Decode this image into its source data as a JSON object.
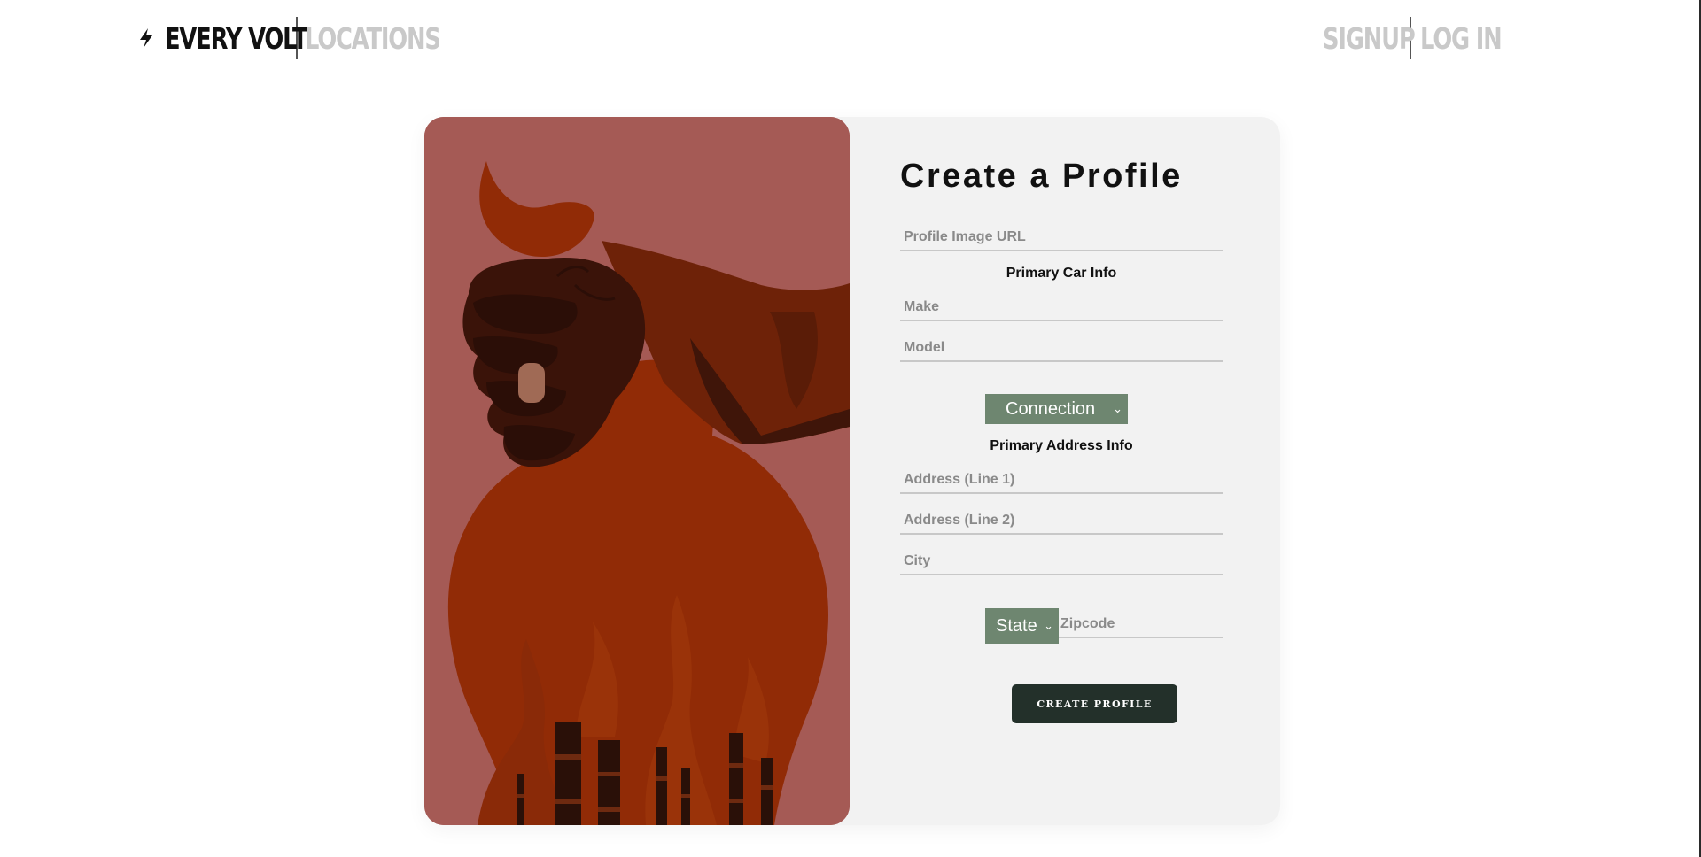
{
  "nav": {
    "brand": "EVERY VOLT",
    "brand_icon": "bolt-icon",
    "locations": "LOCATIONS",
    "signup": "SIGNUP",
    "login": "LOG IN"
  },
  "form": {
    "title": "Create a Profile",
    "profile_image_placeholder": "Profile Image URL",
    "car_section": "Primary Car Info",
    "make_placeholder": "Make",
    "model_placeholder": "Model",
    "connection_select": "Connection",
    "address_section": "Primary Address Info",
    "address1_placeholder": "Address (Line 1)",
    "address2_placeholder": "Address (Line 2)",
    "city_placeholder": "City",
    "state_select": "State",
    "zipcode_placeholder": "Zipcode",
    "submit_label": "CREATE PROFILE"
  },
  "colors": {
    "illustration_bg": "#a55a55",
    "select_bg": "#6e8670",
    "button_bg": "#23302a",
    "card_bg": "#f2f2f2"
  }
}
